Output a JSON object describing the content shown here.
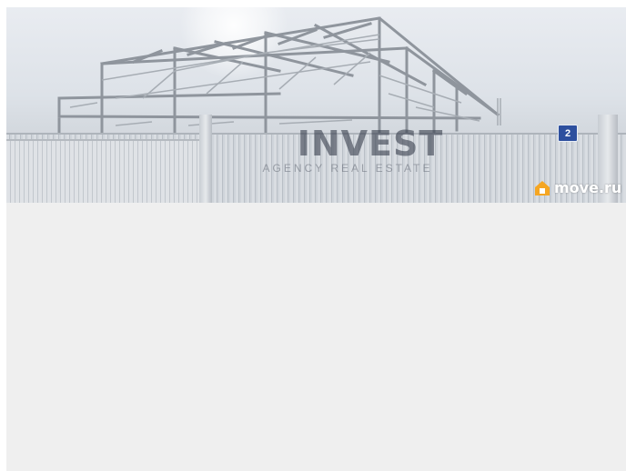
{
  "photo": {
    "watermark_brand": "INVEST",
    "watermark_subtitle": "AGENCY REAL ESTATE",
    "gate_number": "2",
    "credit_text": "move.ru",
    "credit_icon": "house-logo-icon",
    "colors": {
      "background": "#efefef",
      "plate": "#2d4f9e",
      "credit_icon": "#f5a623"
    }
  }
}
